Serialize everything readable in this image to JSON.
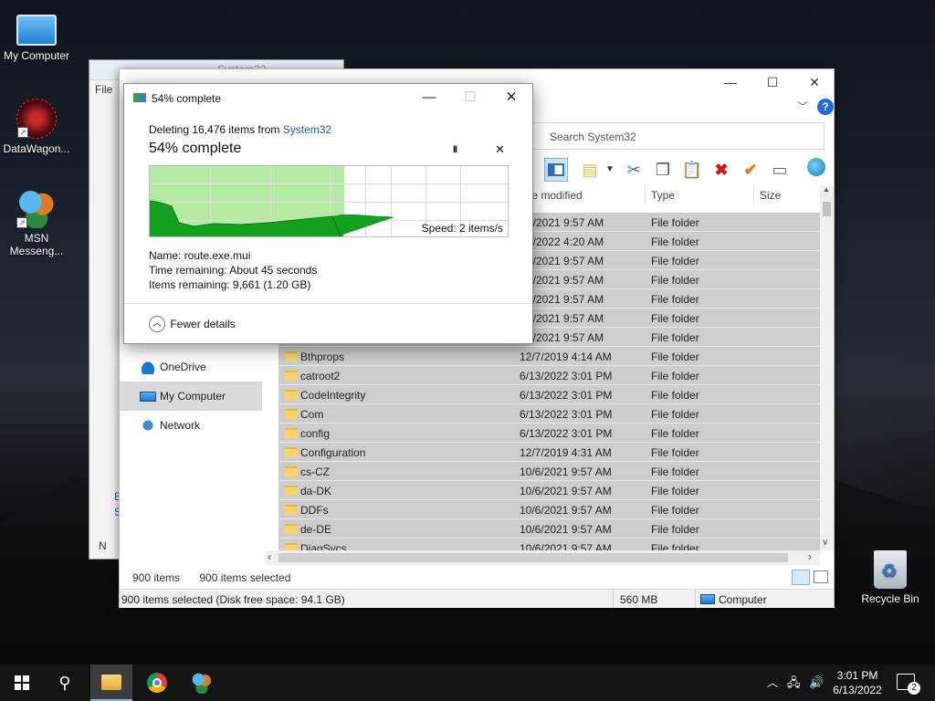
{
  "desktop": {
    "icons": [
      {
        "label": "My Computer"
      },
      {
        "label": "DataWagon..."
      },
      {
        "label": "MSN Messeng..."
      },
      {
        "label": "Recycle Bin"
      }
    ]
  },
  "back_window": {
    "title": "System32",
    "menu_file": "File",
    "link_1": "E",
    "link_2": "S",
    "bottom_label": "N"
  },
  "explorer": {
    "search_placeholder": "Search System32",
    "columns": {
      "date": "te modified",
      "type": "Type",
      "size": "Size"
    },
    "nav": [
      {
        "label": "OneDrive"
      },
      {
        "label": "My Computer"
      },
      {
        "label": "Network"
      }
    ],
    "rows": [
      {
        "name": "",
        "date": "6/2021 9:57 AM",
        "type": "File folder"
      },
      {
        "name": "",
        "date": "3/2022 4:20 AM",
        "type": "File folder"
      },
      {
        "name": "",
        "date": "6/2021 9:57 AM",
        "type": "File folder"
      },
      {
        "name": "",
        "date": "6/2021 9:57 AM",
        "type": "File folder"
      },
      {
        "name": "",
        "date": "6/2021 9:57 AM",
        "type": "File folder"
      },
      {
        "name": "",
        "date": "6/2021 9:57 AM",
        "type": "File folder"
      },
      {
        "name": "",
        "date": "6/2021 9:57 AM",
        "type": "File folder"
      },
      {
        "name": "Bthprops",
        "date": "12/7/2019 4:14 AM",
        "type": "File folder"
      },
      {
        "name": "catroot2",
        "date": "6/13/2022 3:01 PM",
        "type": "File folder"
      },
      {
        "name": "CodeIntegrity",
        "date": "6/13/2022 3:01 PM",
        "type": "File folder"
      },
      {
        "name": "Com",
        "date": "6/13/2022 3:01 PM",
        "type": "File folder"
      },
      {
        "name": "config",
        "date": "6/13/2022 3:01 PM",
        "type": "File folder"
      },
      {
        "name": "Configuration",
        "date": "12/7/2019 4:31 AM",
        "type": "File folder"
      },
      {
        "name": "cs-CZ",
        "date": "10/6/2021 9:57 AM",
        "type": "File folder"
      },
      {
        "name": "da-DK",
        "date": "10/6/2021 9:57 AM",
        "type": "File folder"
      },
      {
        "name": "DDFs",
        "date": "10/6/2021 9:57 AM",
        "type": "File folder"
      },
      {
        "name": "de-DE",
        "date": "10/6/2021 9:57 AM",
        "type": "File folder"
      },
      {
        "name": "DiagSvcs",
        "date": "10/6/2021 9:57 AM",
        "type": "File folder"
      }
    ],
    "status_items": "900 items",
    "status_selected": "900 items selected",
    "status_bar_left": "900 items selected (Disk free space: 94.1 GB)",
    "status_bar_size": "560 MB",
    "status_bar_location": "Computer"
  },
  "dialog": {
    "title": "54% complete",
    "deleting_prefix": "Deleting 16,476 items from",
    "deleting_target": "System32",
    "percent_heading": "54% complete",
    "progress": 0.54,
    "speed": "Speed: 2 items/s",
    "name_label": "Name:",
    "name_value": "route.exe.mui",
    "time_label": "Time remaining:",
    "time_value": "About 45 seconds",
    "items_label": "Items remaining:",
    "items_value": "9,661 (1.20 GB)",
    "fewer_details": "Fewer details",
    "pause_glyph": "II",
    "close_glyph": "✕"
  },
  "taskbar": {
    "time": "3:01 PM",
    "date": "6/13/2022",
    "notification_count": "2"
  },
  "colors": {
    "accent": "#1a56c7",
    "progress_fill": "#b5eaa5",
    "progress_line": "#14a01e",
    "selection": "#cdcdcd",
    "taskbar": "#141414"
  }
}
